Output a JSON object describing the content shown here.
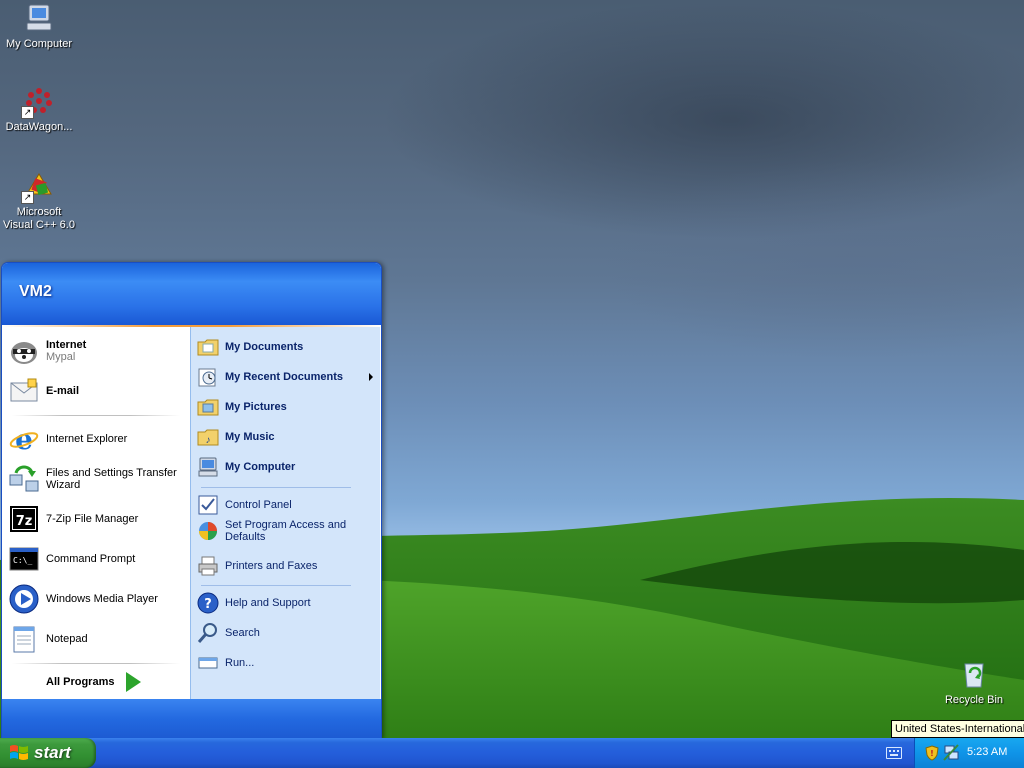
{
  "desktop": {
    "icons": [
      {
        "label": "My Computer",
        "icon": "computer-icon"
      },
      {
        "label": "DataWagon...",
        "icon": "datawagon-icon"
      },
      {
        "label": "Microsoft Visual C++ 6.0",
        "icon": "visual-cpp-icon"
      },
      {
        "label": "Recycle Bin",
        "icon": "recycle-bin-icon"
      }
    ]
  },
  "start_menu": {
    "user": "VM2",
    "pinned": [
      {
        "label": "Internet",
        "sub": "Mypal",
        "icon": "mypal-browser-icon"
      },
      {
        "label": "E-mail",
        "icon": "email-icon"
      }
    ],
    "recent": [
      {
        "label": "Internet Explorer",
        "icon": "internet-explorer-icon"
      },
      {
        "label": "Files and Settings Transfer Wizard",
        "icon": "transfer-wizard-icon"
      },
      {
        "label": "7-Zip File Manager",
        "icon": "7zip-icon"
      },
      {
        "label": "Command Prompt",
        "icon": "command-prompt-icon"
      },
      {
        "label": "Windows Media Player",
        "icon": "media-player-icon"
      },
      {
        "label": "Notepad",
        "icon": "notepad-icon"
      }
    ],
    "all_programs": "All Programs",
    "right_places": [
      {
        "label": "My Documents",
        "icon": "folder-documents-icon"
      },
      {
        "label": "My Recent Documents",
        "icon": "recent-documents-icon"
      },
      {
        "label": "My Pictures",
        "icon": "folder-pictures-icon"
      },
      {
        "label": "My Music",
        "icon": "folder-music-icon"
      },
      {
        "label": "My Computer",
        "icon": "computer-icon"
      }
    ],
    "right_system": [
      {
        "label": "Control Panel",
        "icon": "control-panel-icon"
      },
      {
        "label": "Set Program Access and Defaults",
        "icon": "program-defaults-icon"
      },
      {
        "label": "Printers and Faxes",
        "icon": "printer-icon"
      }
    ],
    "right_help": [
      {
        "label": "Help and Support",
        "icon": "help-icon"
      },
      {
        "label": "Search",
        "icon": "search-icon"
      },
      {
        "label": "Run...",
        "icon": "run-icon"
      }
    ]
  },
  "taskbar": {
    "start_label": "start",
    "clock": "5:23 AM",
    "tray_icons": [
      "keyboard-icon",
      "security-shield-icon",
      "network-icon"
    ],
    "tooltip": "United States-International"
  },
  "colors": {
    "taskbar_blue": "#245edb",
    "start_green": "#3d9a3d",
    "menu_right_panel": "#d3e5fa",
    "tray_blue": "#0f94e8"
  }
}
